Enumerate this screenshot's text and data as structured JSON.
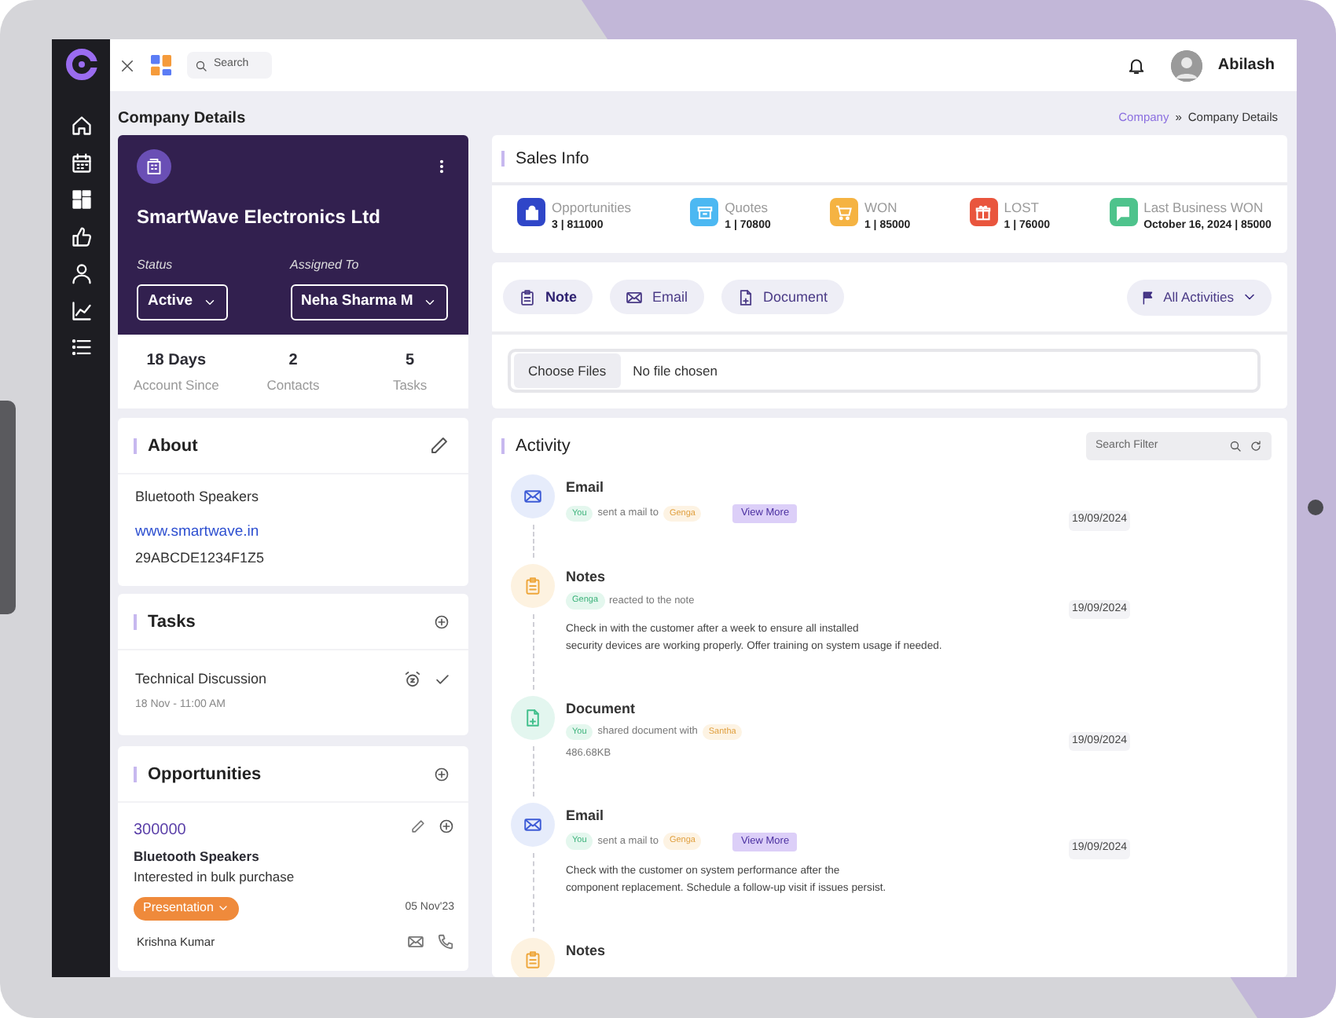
{
  "topbar": {
    "search_placeholder": "Search",
    "user_name": "Abilash"
  },
  "page_title": "Company Details",
  "breadcrumb_separator": "»",
  "breadcrumb": [
    {
      "label": "Company",
      "current": false
    },
    {
      "label": "Company Details",
      "current": true
    }
  ],
  "company": {
    "name": "SmartWave Electronics Ltd",
    "status_label": "Status",
    "status": "Active",
    "assigned_label": "Assigned To",
    "assigned": "Neha Sharma M"
  },
  "stats": [
    {
      "value": "18 Days",
      "label": "Account Since"
    },
    {
      "value": "2",
      "label": "Contacts"
    },
    {
      "value": "5",
      "label": "Tasks"
    }
  ],
  "about": {
    "title": "About",
    "description": "Bluetooth Speakers",
    "website": "www.smartwave.in",
    "tax_id": "29ABCDE1234F1Z5"
  },
  "tasks": {
    "title": "Tasks",
    "items": [
      {
        "name": "Technical Discussion",
        "time": "18 Nov - 11:00 AM"
      }
    ]
  },
  "opportunities": {
    "title": "Opportunities",
    "items": [
      {
        "amount": "300000",
        "product": "Bluetooth Speakers",
        "note": "Interested in bulk purchase",
        "stage": "Presentation",
        "date": "05 Nov'23",
        "contact": "Krishna Kumar"
      }
    ]
  },
  "sales_info": {
    "title": "Sales Info",
    "items": [
      {
        "kind": "bag",
        "label": "Opportunities",
        "value": "3 | 811000",
        "color": "#2f46c8"
      },
      {
        "kind": "box",
        "label": "Quotes",
        "value": "1 | 70800",
        "color": "#4cb8f2"
      },
      {
        "kind": "cart",
        "label": "WON",
        "value": "1 | 85000",
        "color": "#f5b342"
      },
      {
        "kind": "gift",
        "label": "LOST",
        "value": "1 | 76000",
        "color": "#e9553d"
      },
      {
        "kind": "chat",
        "label": "Last Business WON",
        "value": "October 16, 2024 | 85000",
        "color": "#4ec38c"
      }
    ]
  },
  "activity_tabs": [
    {
      "kind": "note",
      "label": "Note",
      "selected": true
    },
    {
      "kind": "email",
      "label": "Email",
      "selected": false
    },
    {
      "kind": "document",
      "label": "Document",
      "selected": false
    }
  ],
  "activity_filter": "All Activities",
  "file_input": {
    "button": "Choose Files",
    "status": "No file chosen"
  },
  "activity": {
    "title": "Activity",
    "search_placeholder": "Search Filter",
    "items": [
      {
        "kind": "email",
        "title": "Email",
        "actor": "You",
        "action": "sent a mail to",
        "target": "Genga",
        "button": "View More",
        "date": "19/09/2024"
      },
      {
        "kind": "notes",
        "title": "Notes",
        "actor": "Genga",
        "action": "reacted to the note",
        "date": "19/09/2024",
        "description": [
          "Check in with the customer after a week to ensure all installed",
          "security devices are working properly. Offer training on system usage if needed."
        ]
      },
      {
        "kind": "document",
        "title": "Document",
        "actor": "You",
        "action": "shared document with",
        "target": "Santha",
        "date": "19/09/2024",
        "size": "486.68KB"
      },
      {
        "kind": "email",
        "title": "Email",
        "actor": "You",
        "action": "sent a mail to",
        "target": "Genga",
        "button": "View More",
        "date": "19/09/2024",
        "description": [
          "Check with the customer on system performance after the",
          "component replacement. Schedule a follow-up visit if issues persist."
        ]
      },
      {
        "kind": "notes",
        "title": "Notes"
      }
    ]
  }
}
